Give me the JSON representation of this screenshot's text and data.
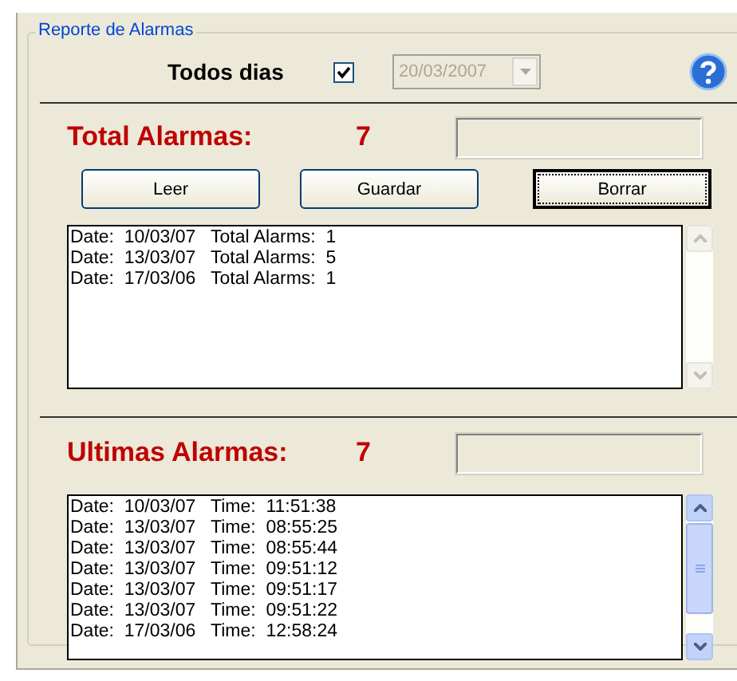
{
  "group": {
    "title": "Reporte de Alarmas"
  },
  "filter": {
    "label": "Todos dias",
    "checked": true,
    "date": "20/03/2007",
    "date_disabled": true
  },
  "total": {
    "label": "Total Alarmas:",
    "count": "7"
  },
  "buttons": [
    {
      "label": "Leer",
      "focused": false
    },
    {
      "label": "Guardar",
      "focused": false
    },
    {
      "label": "Borrar",
      "focused": true
    }
  ],
  "total_list": {
    "scrollbar_enabled": false,
    "rows": [
      "Date:  10/03/07   Total Alarms:  1",
      "Date:  13/03/07   Total Alarms:  5",
      "Date:  17/03/06   Total Alarms:  1"
    ]
  },
  "last": {
    "label": "Ultimas Alarmas:",
    "count": "7"
  },
  "last_list": {
    "scrollbar_enabled": true,
    "rows": [
      "Date:  10/03/07   Time:  11:51:38",
      "Date:  13/03/07   Time:  08:55:25",
      "Date:  13/03/07   Time:  08:55:44",
      "Date:  13/03/07   Time:  09:51:12",
      "Date:  13/03/07   Time:  09:51:17",
      "Date:  13/03/07   Time:  09:51:22",
      "Date:  17/03/06   Time:  12:58:24"
    ]
  }
}
